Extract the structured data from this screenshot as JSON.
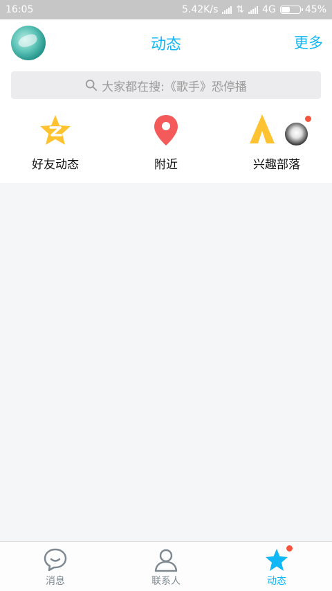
{
  "status_bar": {
    "time": "16:05",
    "network_speed": "5.42K/s",
    "network_type": "4G",
    "battery": "45%"
  },
  "header": {
    "title": "动态",
    "more_label": "更多"
  },
  "search": {
    "text": "大家都在搜:《歌手》恐停播"
  },
  "quick_entries": [
    {
      "label": "好友动态",
      "icon": "qzone-star-icon"
    },
    {
      "label": "附近",
      "icon": "location-pin-icon"
    },
    {
      "label": "兴趣部落",
      "icon": "tribe-tent-icon"
    }
  ],
  "tabs": [
    {
      "label": "消息",
      "icon": "chat-bubble-icon"
    },
    {
      "label": "联系人",
      "icon": "contacts-person-icon"
    },
    {
      "label": "动态",
      "icon": "star-icon",
      "active": true
    }
  ],
  "colors": {
    "accent": "#12b7f5",
    "badge": "#f5533d"
  }
}
